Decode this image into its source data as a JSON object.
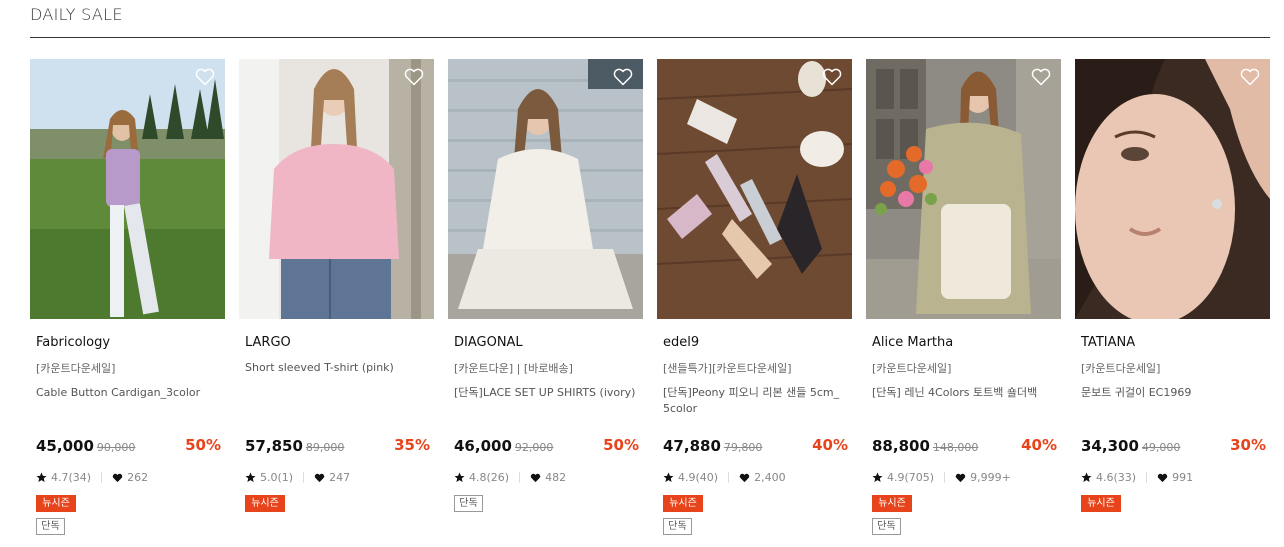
{
  "section": {
    "title": "DAILY SALE"
  },
  "products": [
    {
      "brand": "Fabricology",
      "tagline": "[카운트다운세일]",
      "name": "Cable Button Cardigan_3color",
      "price": "45,000",
      "original_price": "90,000",
      "discount": "50%",
      "rating": "4.7(34)",
      "likes": "262",
      "badges": [
        "뉴시즌",
        "단독"
      ]
    },
    {
      "brand": "LARGO",
      "tagline": "",
      "name": "Short sleeved T-shirt (pink)",
      "price": "57,850",
      "original_price": "89,000",
      "discount": "35%",
      "rating": "5.0(1)",
      "likes": "247",
      "badges": [
        "뉴시즌"
      ]
    },
    {
      "brand": "DIAGONAL",
      "tagline": "[카운트다운] | [바로배송]",
      "name": "[단독]LACE SET UP SHIRTS (ivory)",
      "price": "46,000",
      "original_price": "92,000",
      "discount": "50%",
      "rating": "4.8(26)",
      "likes": "482",
      "badges": [
        "단독"
      ]
    },
    {
      "brand": "edel9",
      "tagline": "[샌들특가][카운트다운세일]",
      "name": "[단독]Peony 피오니 리본 샌들 5cm_ 5color",
      "price": "47,880",
      "original_price": "79,800",
      "discount": "40%",
      "rating": "4.9(40)",
      "likes": "2,400",
      "badges": [
        "뉴시즌",
        "단독"
      ]
    },
    {
      "brand": "Alice Martha",
      "tagline": "[카운트다운세일]",
      "name": "[단독] 레닌 4Colors 토트백 숄더백",
      "price": "88,800",
      "original_price": "148,000",
      "discount": "40%",
      "rating": "4.9(705)",
      "likes": "9,999+",
      "badges": [
        "뉴시즌",
        "단독"
      ]
    },
    {
      "brand": "TATIANA",
      "tagline": "[카운트다운세일]",
      "name": "문보트 귀걸이 EC1969",
      "price": "34,300",
      "original_price": "49,000",
      "discount": "30%",
      "rating": "4.6(33)",
      "likes": "991",
      "badges": [
        "뉴시즌"
      ]
    }
  ],
  "icons": {
    "wishlist": "heart-outline-icon",
    "rating": "star-icon",
    "likes": "heart-filled-icon"
  },
  "colors": {
    "discount": "#e8441b",
    "new_season_badge": "#e8441b",
    "exclusive_badge_border": "#999999"
  }
}
